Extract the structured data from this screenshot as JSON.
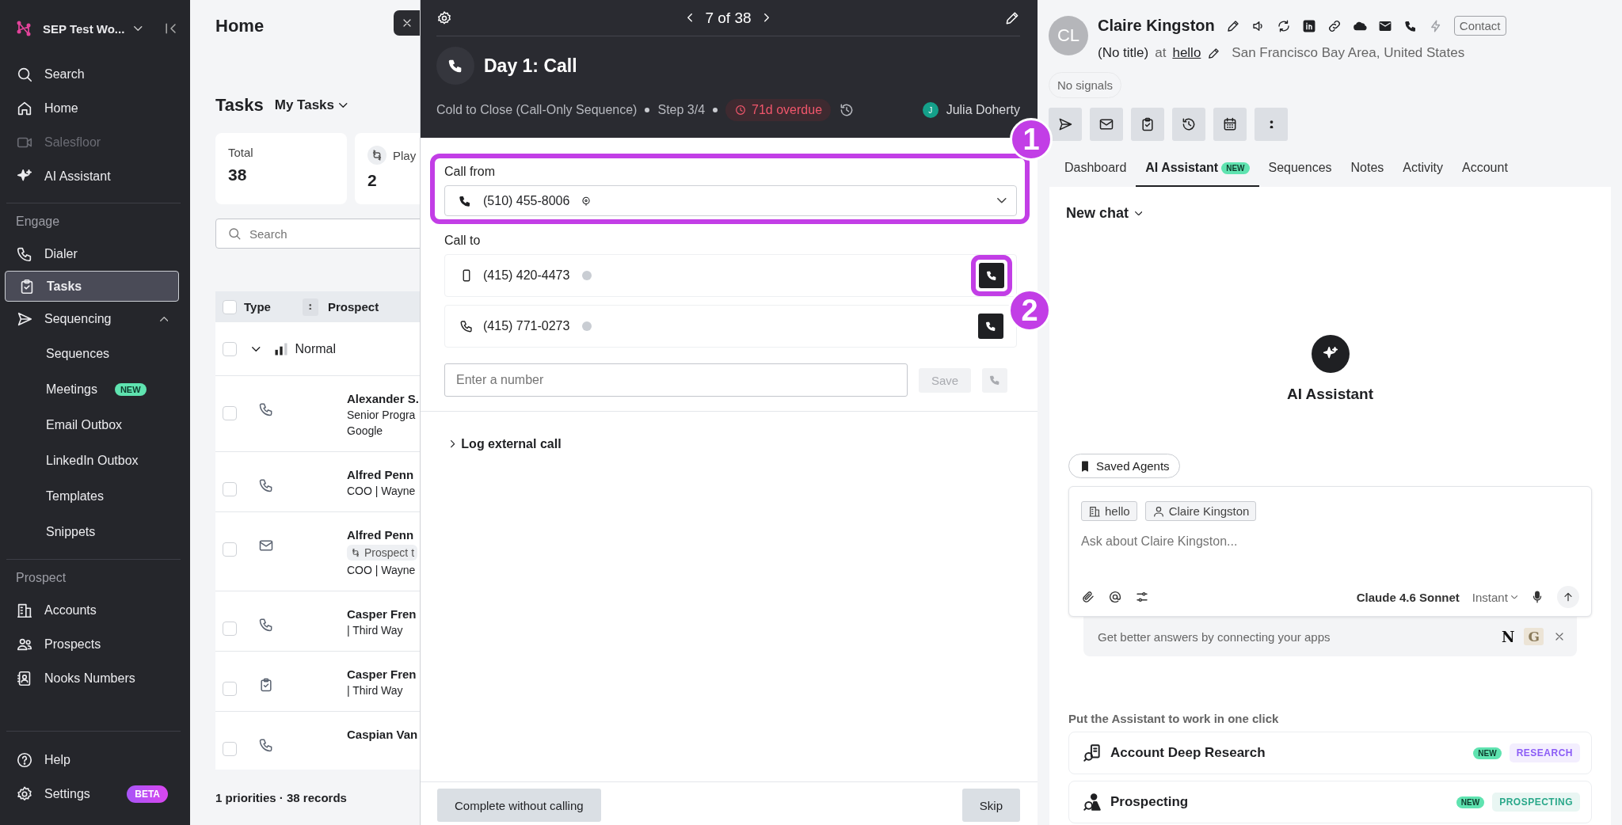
{
  "sidebar": {
    "workspace": "SEP Test Wo...",
    "top_items": [
      {
        "label": "Search",
        "selected": false,
        "disabled": false
      },
      {
        "label": "Home",
        "selected": false,
        "disabled": false
      },
      {
        "label": "Salesfloor",
        "selected": false,
        "disabled": true
      },
      {
        "label": "AI Assistant",
        "selected": false,
        "disabled": false
      }
    ],
    "sections": [
      {
        "title": "Engage",
        "items": [
          {
            "label": "Dialer",
            "selected": false
          },
          {
            "label": "Tasks",
            "selected": true
          },
          {
            "label": "Sequencing",
            "selected": false,
            "expanded": true,
            "children": [
              {
                "label": "Sequences",
                "selected": false
              },
              {
                "label": "Meetings",
                "selected": false,
                "badge": "NEW"
              },
              {
                "label": "Email Outbox",
                "selected": false
              },
              {
                "label": "LinkedIn Outbox",
                "selected": false
              },
              {
                "label": "Templates",
                "selected": false
              },
              {
                "label": "Snippets",
                "selected": false
              }
            ]
          }
        ]
      },
      {
        "title": "Prospect",
        "items": [
          {
            "label": "Accounts",
            "selected": false
          },
          {
            "label": "Prospects",
            "selected": false
          },
          {
            "label": "Nooks Numbers",
            "selected": false
          }
        ]
      }
    ],
    "bottom_items": [
      {
        "label": "Help",
        "selected": false
      },
      {
        "label": "Settings",
        "selected": false,
        "badge": "BETA"
      }
    ]
  },
  "main": {
    "title": "Home",
    "tasks_title": "Tasks",
    "filter": "My Tasks",
    "stats": [
      {
        "label": "Total",
        "value": "38"
      },
      {
        "label": "Play",
        "value": "2"
      }
    ],
    "search_placeholder": "Search",
    "columns": [
      "Type",
      "Prospect"
    ],
    "all_checked": false,
    "group": {
      "label": "Normal",
      "checked": false,
      "expanded": true
    },
    "rows": [
      {
        "kind": "call",
        "checked": false,
        "name": "Alexander S.",
        "lines": [
          "Senior Progra",
          "Google"
        ]
      },
      {
        "kind": "call",
        "checked": false,
        "name": "Alfred Penn",
        "lines": [
          "COO | Wayne"
        ]
      },
      {
        "kind": "email",
        "checked": false,
        "name": "Alfred Penn",
        "tag": "Prospect t",
        "lines": [
          "COO | Wayne"
        ]
      },
      {
        "kind": "call",
        "checked": false,
        "name": "Casper Fren",
        "lines": [
          "| Third Way"
        ]
      },
      {
        "kind": "task",
        "checked": false,
        "name": "Casper Fren",
        "lines": [
          "| Third Way"
        ]
      },
      {
        "kind": "call",
        "checked": false,
        "name": "Caspian Van"
      }
    ],
    "footer": "1 priorities · 38 records"
  },
  "task_modal": {
    "position": "7 of 38",
    "title": "Day 1: Call",
    "sequence": "Cold to Close (Call-Only Sequence)",
    "step": "Step 3/4",
    "overdue": "71d overdue",
    "owner": {
      "initial": "J",
      "name": "Julia Doherty"
    },
    "call_from": {
      "label": "Call from",
      "number": "(510) 455-8006"
    },
    "call_to": {
      "label": "Call to",
      "numbers": [
        {
          "kind": "mobile",
          "number": "(415) 420-4473"
        },
        {
          "kind": "landline",
          "number": "(415) 771-0273"
        }
      ]
    },
    "manual_entry": {
      "placeholder": "Enter a number",
      "save": "Save",
      "disabled": true
    },
    "log_external": {
      "label": "Log external call",
      "expanded": false
    },
    "footer": {
      "complete": "Complete without calling",
      "skip": "Skip"
    }
  },
  "annotations": [
    {
      "label": "1"
    },
    {
      "label": "2"
    }
  ],
  "contact": {
    "initials": "CL",
    "name": "Claire Kingston",
    "record_type": "Contact",
    "title": "(No title)",
    "at": "at",
    "company": "hello",
    "location": "San Francisco Bay Area, United States",
    "signals": "No signals",
    "tabs": [
      {
        "label": "Dashboard",
        "selected": false
      },
      {
        "label": "AI Assistant",
        "selected": true,
        "badge": "NEW"
      },
      {
        "label": "Sequences",
        "selected": false
      },
      {
        "label": "Notes",
        "selected": false
      },
      {
        "label": "Activity",
        "selected": false
      },
      {
        "label": "Account",
        "selected": false
      }
    ],
    "assistant": {
      "chat_menu": "New chat",
      "heading": "AI Assistant",
      "saved_agents": "Saved Agents",
      "context_chips": [
        {
          "kind": "account",
          "label": "hello"
        },
        {
          "kind": "person",
          "label": "Claire Kingston"
        }
      ],
      "placeholder": "Ask about Claire Kingston...",
      "model": "Claude 4.6 Sonnet",
      "mode": "Instant",
      "connect_banner": {
        "text": "Get better answers by connecting your apps",
        "apps": [
          "N",
          "G"
        ]
      },
      "quick_actions_title": "Put the Assistant to work in one click",
      "agents": [
        {
          "label": "Account Deep Research",
          "badge": "NEW",
          "tag": "RESEARCH",
          "color": "#8b5cf6"
        },
        {
          "label": "Prospecting",
          "badge": "NEW",
          "tag": "PROSPECTING",
          "color": "#2aa88a"
        }
      ]
    }
  }
}
